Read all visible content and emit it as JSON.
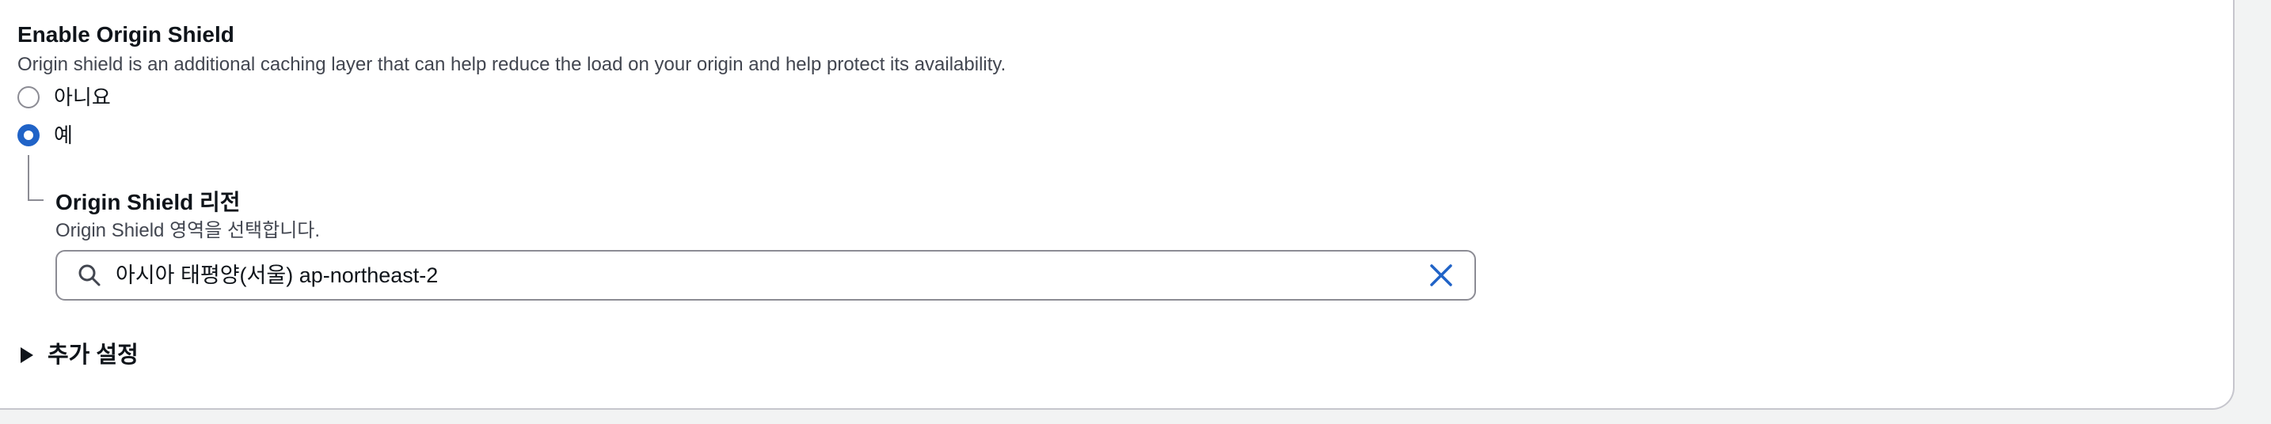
{
  "origin_shield": {
    "title": "Enable Origin Shield",
    "description": "Origin shield is an additional caching layer that can help reduce the load on your origin and help protect its availability.",
    "options": [
      {
        "label": "아니요",
        "selected": false
      },
      {
        "label": "예",
        "selected": true
      }
    ]
  },
  "region": {
    "title": "Origin Shield 리전",
    "description": "Origin Shield 영역을 선택합니다.",
    "search_value": "아시아 태평양(서울) ap-northeast-2",
    "search_icon": "search-icon",
    "clear_icon": "close-icon"
  },
  "additional_settings": {
    "label": "추가 설정",
    "icon": "caret-right-icon",
    "expanded": false
  },
  "colors": {
    "accent": "#2063c7",
    "text": "#0f141a",
    "secondary_text": "#424650",
    "border": "#8c8c94"
  }
}
